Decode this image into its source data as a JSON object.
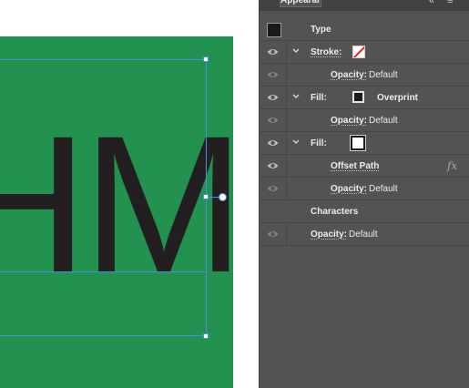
{
  "canvas": {
    "art_text": "HM",
    "colors": {
      "artboard": "#ffffff",
      "fill": "#23914f",
      "text": "#231f20",
      "selection": "#4a90e2"
    }
  },
  "panel": {
    "tab_label": "Appearance",
    "collapse_glyph": "«",
    "menu_glyph": "≡",
    "rows": {
      "type": {
        "label": "Type",
        "icon": "type-thumbnail-icon"
      },
      "stroke": {
        "label": "Stroke:",
        "swatch_color": "none"
      },
      "stroke_opacity": {
        "label": "Opacity:",
        "value": "Default"
      },
      "fill1": {
        "label": "Fill:",
        "swatch_color": "#1b1b1b",
        "extra": "Overprint"
      },
      "fill1_opacity": {
        "label": "Opacity:",
        "value": "Default"
      },
      "fill2": {
        "label": "Fill:",
        "swatch_color": "#ffffff"
      },
      "offset_path": {
        "label": "Offset Path",
        "fx": "fx"
      },
      "fill2_opacity": {
        "label": "Opacity:",
        "value": "Default"
      },
      "characters": {
        "label": "Characters"
      },
      "char_opacity": {
        "label": "Opacity:",
        "value": "Default"
      }
    },
    "colors": {
      "background": "#535353",
      "text": "#ececec",
      "divider": "#474747"
    }
  }
}
